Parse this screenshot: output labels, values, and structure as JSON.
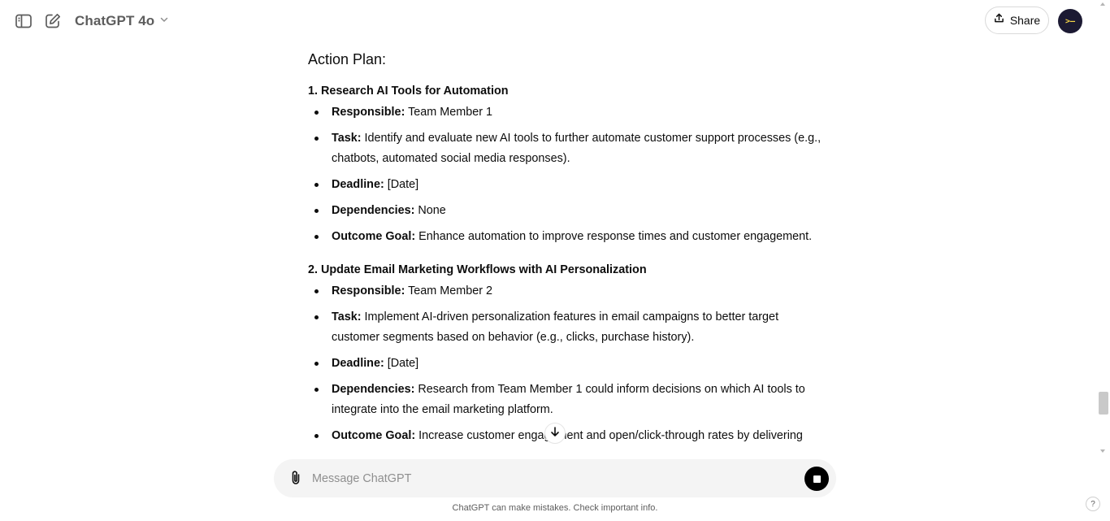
{
  "header": {
    "model_name": "ChatGPT 4o",
    "share_label": "Share",
    "avatar_text": ">—"
  },
  "content": {
    "heading": "Action Plan:",
    "items": [
      {
        "title": "1. Research AI Tools for Automation",
        "bullets": [
          {
            "label": "Responsible:",
            "text": " Team Member 1"
          },
          {
            "label": "Task:",
            "text": " Identify and evaluate new AI tools to further automate customer support processes (e.g., chatbots, automated social media responses)."
          },
          {
            "label": "Deadline:",
            "text": " [Date]"
          },
          {
            "label": "Dependencies:",
            "text": " None"
          },
          {
            "label": "Outcome Goal:",
            "text": " Enhance automation to improve response times and customer engagement."
          }
        ]
      },
      {
        "title": "2. Update Email Marketing Workflows with AI Personalization",
        "bullets": [
          {
            "label": "Responsible:",
            "text": " Team Member 2"
          },
          {
            "label": "Task:",
            "text": " Implement AI-driven personalization features in email campaigns to better target customer segments based on behavior (e.g., clicks, purchase history)."
          },
          {
            "label": "Deadline:",
            "text": " [Date]"
          },
          {
            "label": "Dependencies:",
            "text": " Research from Team Member 1 could inform decisions on which AI tools to integrate into the email marketing platform."
          },
          {
            "label": "Outcome Goal:",
            "text": " Increase customer engagement and open/click-through rates by delivering"
          }
        ]
      }
    ]
  },
  "composer": {
    "placeholder": "Message ChatGPT"
  },
  "footer": {
    "disclaimer": "ChatGPT can make mistakes. Check important info.",
    "help_label": "?"
  },
  "icons": {
    "sidebar": "sidebar-toggle-icon",
    "new_chat": "new-chat-icon",
    "chevron": "chevron-down-icon",
    "share": "share-upload-icon",
    "attach": "paperclip-icon",
    "stop": "stop-icon",
    "scroll": "arrow-down-icon"
  },
  "colors": {
    "text": "#0d0d0d",
    "muted": "#5d5d5d",
    "composer_bg": "#f4f4f4",
    "avatar_bg": "#1c1a33"
  }
}
